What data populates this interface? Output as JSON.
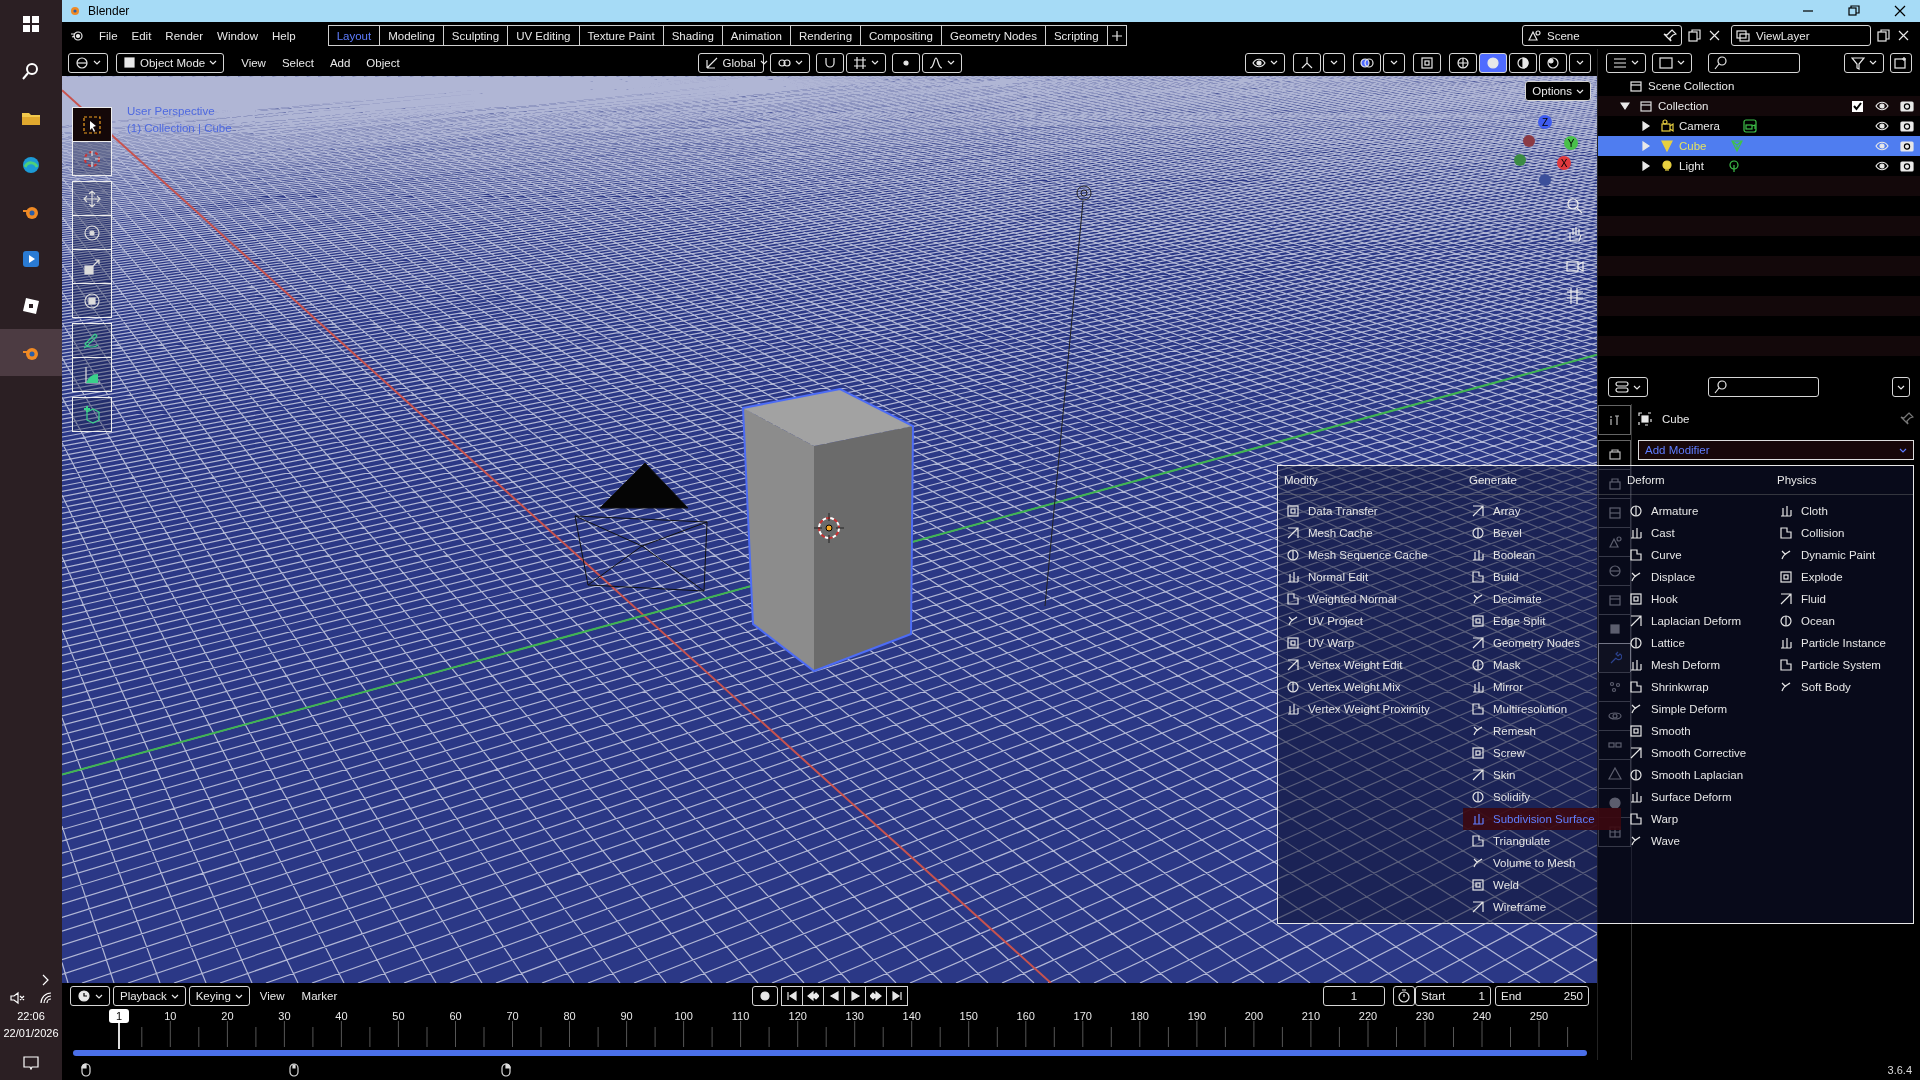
{
  "window": {
    "title": "Blender"
  },
  "clock": {
    "time": "22:06",
    "date": "22/01/2026"
  },
  "menubar": [
    "File",
    "Edit",
    "Render",
    "Window",
    "Help"
  ],
  "workspace_tabs": [
    {
      "label": "Layout",
      "selected": true
    },
    {
      "label": "Modeling",
      "selected": false
    },
    {
      "label": "Sculpting",
      "selected": false
    },
    {
      "label": "UV Editing",
      "selected": false
    },
    {
      "label": "Texture Paint",
      "selected": false
    },
    {
      "label": "Shading",
      "selected": false
    },
    {
      "label": "Animation",
      "selected": false
    },
    {
      "label": "Rendering",
      "selected": false
    },
    {
      "label": "Compositing",
      "selected": false
    },
    {
      "label": "Geometry Nodes",
      "selected": false
    },
    {
      "label": "Scripting",
      "selected": false
    }
  ],
  "scene": "Scene",
  "view_layer": "ViewLayer",
  "viewport_header": {
    "mode": "Object Mode",
    "menus": [
      "View",
      "Select",
      "Add",
      "Object"
    ],
    "orientation": "Global",
    "options": "Options"
  },
  "viewport": {
    "info": [
      "User Perspective",
      "(1) Collection | Cube"
    ],
    "gizmo_axes": [
      "Z",
      "Y",
      "X"
    ]
  },
  "outliner": {
    "root": "Scene Collection",
    "items": [
      {
        "name": "Collection",
        "kind": "collection",
        "expanded": true,
        "selected": false,
        "checked": true,
        "children": [
          {
            "name": "Camera",
            "kind": "camera",
            "expanded": false,
            "selected": false
          },
          {
            "name": "Cube",
            "kind": "mesh",
            "expanded": false,
            "selected": true
          },
          {
            "name": "Light",
            "kind": "light",
            "expanded": false,
            "selected": false
          }
        ]
      }
    ]
  },
  "properties": {
    "object_name": "Cube",
    "add_modifier": "Add Modifier",
    "tabs": [
      {
        "kind": "tool",
        "selected": false
      },
      {
        "kind": "render",
        "selected": false
      },
      {
        "kind": "output",
        "selected": false
      },
      {
        "kind": "view_layer",
        "selected": false
      },
      {
        "kind": "scene",
        "selected": false
      },
      {
        "kind": "world",
        "selected": false
      },
      {
        "kind": "collection",
        "selected": false
      },
      {
        "kind": "object",
        "selected": false
      },
      {
        "kind": "modifiers",
        "selected": true
      },
      {
        "kind": "particles",
        "selected": false
      },
      {
        "kind": "physics",
        "selected": false
      },
      {
        "kind": "constraints",
        "selected": false
      },
      {
        "kind": "data",
        "selected": false
      },
      {
        "kind": "material",
        "selected": false
      },
      {
        "kind": "texture",
        "selected": false
      }
    ]
  },
  "modifier_menu": {
    "columns": [
      {
        "heading": "Modify",
        "items": [
          {
            "label": "Data Transfer",
            "selected": false
          },
          {
            "label": "Mesh Cache",
            "selected": false
          },
          {
            "label": "Mesh Sequence Cache",
            "selected": false
          },
          {
            "label": "Normal Edit",
            "selected": false
          },
          {
            "label": "Weighted Normal",
            "selected": false
          },
          {
            "label": "UV Project",
            "selected": false
          },
          {
            "label": "UV Warp",
            "selected": false
          },
          {
            "label": "Vertex Weight Edit",
            "selected": false
          },
          {
            "label": "Vertex Weight Mix",
            "selected": false
          },
          {
            "label": "Vertex Weight Proximity",
            "selected": false
          }
        ]
      },
      {
        "heading": "Generate",
        "items": [
          {
            "label": "Array",
            "selected": false
          },
          {
            "label": "Bevel",
            "selected": false
          },
          {
            "label": "Boolean",
            "selected": false
          },
          {
            "label": "Build",
            "selected": false
          },
          {
            "label": "Decimate",
            "selected": false
          },
          {
            "label": "Edge Split",
            "selected": false
          },
          {
            "label": "Geometry Nodes",
            "selected": false
          },
          {
            "label": "Mask",
            "selected": false
          },
          {
            "label": "Mirror",
            "selected": false
          },
          {
            "label": "Multiresolution",
            "selected": false
          },
          {
            "label": "Remesh",
            "selected": false
          },
          {
            "label": "Screw",
            "selected": false
          },
          {
            "label": "Skin",
            "selected": false
          },
          {
            "label": "Solidify",
            "selected": false
          },
          {
            "label": "Subdivision Surface",
            "selected": true
          },
          {
            "label": "Triangulate",
            "selected": false
          },
          {
            "label": "Volume to Mesh",
            "selected": false
          },
          {
            "label": "Weld",
            "selected": false
          },
          {
            "label": "Wireframe",
            "selected": false
          }
        ]
      },
      {
        "heading": "Deform",
        "items": [
          {
            "label": "Armature",
            "selected": false
          },
          {
            "label": "Cast",
            "selected": false
          },
          {
            "label": "Curve",
            "selected": false
          },
          {
            "label": "Displace",
            "selected": false
          },
          {
            "label": "Hook",
            "selected": false
          },
          {
            "label": "Laplacian Deform",
            "selected": false
          },
          {
            "label": "Lattice",
            "selected": false
          },
          {
            "label": "Mesh Deform",
            "selected": false
          },
          {
            "label": "Shrinkwrap",
            "selected": false
          },
          {
            "label": "Simple Deform",
            "selected": false
          },
          {
            "label": "Smooth",
            "selected": false
          },
          {
            "label": "Smooth Corrective",
            "selected": false
          },
          {
            "label": "Smooth Laplacian",
            "selected": false
          },
          {
            "label": "Surface Deform",
            "selected": false
          },
          {
            "label": "Warp",
            "selected": false
          },
          {
            "label": "Wave",
            "selected": false
          }
        ]
      },
      {
        "heading": "Physics",
        "items": [
          {
            "label": "Cloth",
            "selected": false
          },
          {
            "label": "Collision",
            "selected": false
          },
          {
            "label": "Dynamic Paint",
            "selected": false
          },
          {
            "label": "Explode",
            "selected": false
          },
          {
            "label": "Fluid",
            "selected": false
          },
          {
            "label": "Ocean",
            "selected": false
          },
          {
            "label": "Particle Instance",
            "selected": false
          },
          {
            "label": "Particle System",
            "selected": false
          },
          {
            "label": "Soft Body",
            "selected": false
          }
        ]
      }
    ]
  },
  "timeline": {
    "menus": [
      {
        "label": "Playback",
        "kind": "dropdown"
      },
      {
        "label": "Keying",
        "kind": "dropdown"
      },
      {
        "label": "View",
        "kind": "menu"
      },
      {
        "label": "Marker",
        "kind": "menu"
      }
    ],
    "current_frame": "1",
    "start_label": "Start",
    "start": "1",
    "end_label": "End",
    "end": "250",
    "playhead": "1",
    "ruler": [
      "10",
      "20",
      "30",
      "40",
      "50",
      "60",
      "70",
      "80",
      "90",
      "100",
      "110",
      "120",
      "130",
      "140",
      "150",
      "160",
      "170",
      "180",
      "190",
      "200",
      "210",
      "220",
      "230",
      "240",
      "250"
    ]
  },
  "status_bar": {
    "version": "3.6.4"
  }
}
